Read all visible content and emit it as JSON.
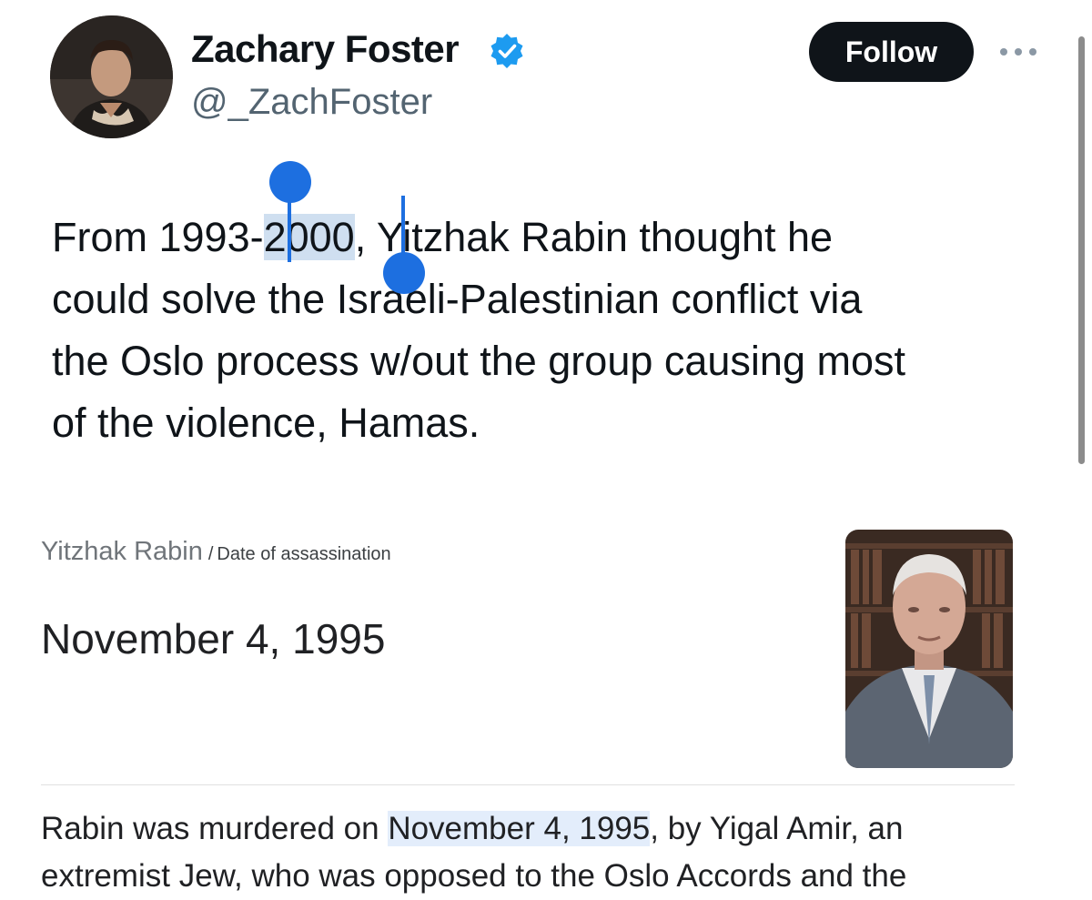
{
  "tweet": {
    "author": {
      "display_name": "Zachary Foster",
      "handle": "@_ZachFoster",
      "verified": true,
      "verified_icon": "verified-badge-icon",
      "avatar_icon": "avatar-photo"
    },
    "follow_label": "Follow",
    "more_icon": "more-options-icon",
    "text": {
      "line1_pre": "From 1993-",
      "line1_selected": "2000",
      "line1_post": ", Yitzhak Rabin thought he",
      "line2": "could solve the Israeli-Palestinian conflict via",
      "line3": "the Oslo process w/out the group causing most",
      "line4": "of the violence, Hamas."
    }
  },
  "knowledge_card": {
    "entity": "Yitzhak Rabin",
    "separator": "/",
    "attribute": "Date of assassination",
    "answer": "November 4, 1995",
    "photo_icon": "rabin-portrait-photo",
    "snippet": {
      "line1_pre": "Rabin was murdered on ",
      "line1_highlight": "November 4, 1995",
      "line1_post": ", by Yigal Amir, an",
      "line2": "extremist Jew, who was opposed to the Oslo Accords and the"
    }
  },
  "colors": {
    "accent": "#1d9bf0",
    "selection_handle": "#1d6fe0",
    "selection_fill": "#cfdff0",
    "follow_bg": "#0f1419",
    "handle_text": "#536471"
  }
}
